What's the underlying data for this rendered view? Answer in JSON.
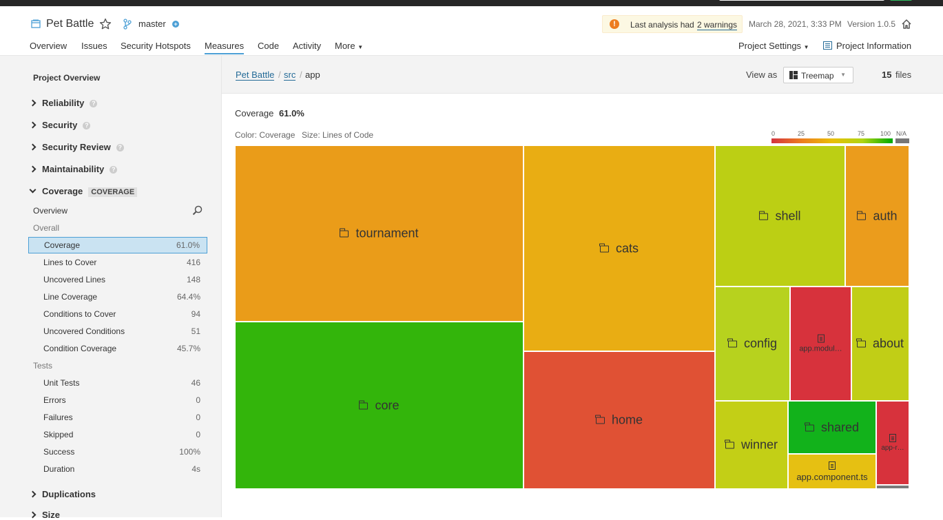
{
  "project": {
    "name": "Pet Battle",
    "branch": "master",
    "warning_prefix": "Last analysis had",
    "warning_link": "2 warnings",
    "date": "March 28, 2021, 3:33 PM",
    "version": "Version 1.0.5"
  },
  "nav": {
    "tabs": [
      "Overview",
      "Issues",
      "Security Hotspots",
      "Measures",
      "Code",
      "Activity",
      "More"
    ],
    "active": "Measures",
    "project_settings": "Project Settings",
    "project_information": "Project Information"
  },
  "sidebar": {
    "title": "Project Overview",
    "domains": [
      "Reliability",
      "Security",
      "Security Review",
      "Maintainability"
    ],
    "coverage_domain": "Coverage",
    "coverage_badge": "COVERAGE",
    "overview": "Overview",
    "overall": "Overall",
    "overall_metrics": [
      {
        "label": "Coverage",
        "value": "61.0%"
      },
      {
        "label": "Lines to Cover",
        "value": "416"
      },
      {
        "label": "Uncovered Lines",
        "value": "148"
      },
      {
        "label": "Line Coverage",
        "value": "64.4%"
      },
      {
        "label": "Conditions to Cover",
        "value": "94"
      },
      {
        "label": "Uncovered Conditions",
        "value": "51"
      },
      {
        "label": "Condition Coverage",
        "value": "45.7%"
      }
    ],
    "tests": "Tests",
    "test_metrics": [
      {
        "label": "Unit Tests",
        "value": "46"
      },
      {
        "label": "Errors",
        "value": "0"
      },
      {
        "label": "Failures",
        "value": "0"
      },
      {
        "label": "Skipped",
        "value": "0"
      },
      {
        "label": "Success",
        "value": "100%"
      },
      {
        "label": "Duration",
        "value": "4s"
      }
    ],
    "bottom_domains": [
      "Duplications",
      "Size"
    ]
  },
  "main": {
    "breadcrumb": [
      "Pet Battle",
      "src",
      "app"
    ],
    "view_as_label": "View as",
    "view_as_value": "Treemap",
    "files_count": "15",
    "files_label": "files",
    "metric_label": "Coverage",
    "metric_value": "61.0%",
    "color_label": "Color: Coverage",
    "size_label": "Size: Lines of Code",
    "legend_ticks": [
      "0",
      "25",
      "50",
      "75",
      "100"
    ],
    "legend_na": "N/A"
  },
  "treemap": [
    {
      "name": "tournament",
      "kind": "dir",
      "color": "#ea9c19"
    },
    {
      "name": "core",
      "kind": "dir",
      "color": "#33b50b"
    },
    {
      "name": "cats",
      "kind": "dir",
      "color": "#e9ad13"
    },
    {
      "name": "home",
      "kind": "dir",
      "color": "#e05134"
    },
    {
      "name": "shell",
      "kind": "dir",
      "color": "#bccf14"
    },
    {
      "name": "auth",
      "kind": "dir",
      "color": "#eb9c1c"
    },
    {
      "name": "config",
      "kind": "dir",
      "color": "#b7d21e"
    },
    {
      "name": "app.modul…",
      "kind": "file",
      "color": "#d7323c"
    },
    {
      "name": "about",
      "kind": "dir",
      "color": "#c1ce16"
    },
    {
      "name": "winner",
      "kind": "dir",
      "color": "#c3cf16"
    },
    {
      "name": "shared",
      "kind": "dir",
      "color": "#12b21b"
    },
    {
      "name": "app.component.ts",
      "kind": "file",
      "color": "#e6c012"
    },
    {
      "name": "app-r…",
      "kind": "file",
      "color": "#d7323c"
    },
    {
      "name": "",
      "kind": "na",
      "color": "#7a7a7a"
    }
  ]
}
